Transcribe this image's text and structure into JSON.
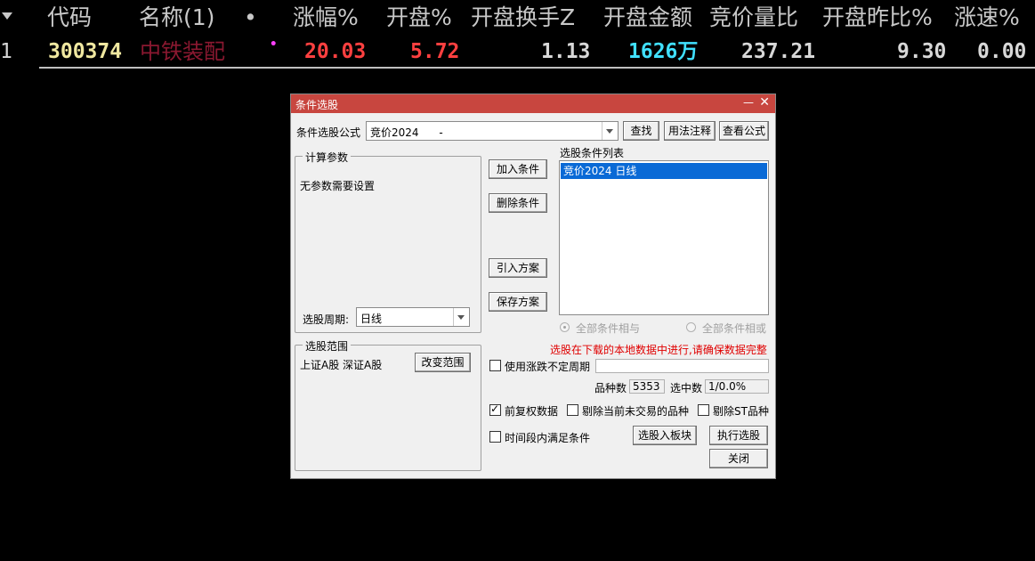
{
  "table": {
    "headers": [
      "代码",
      "名称(1)",
      "•",
      "涨幅%",
      "开盘%",
      "开盘换手Z",
      "开盘金额",
      "竞价量比",
      "开盘昨比%",
      "涨速%"
    ],
    "row": {
      "index": "1",
      "code": "300374",
      "name": "中铁装配",
      "marker": "•",
      "change_pct": "20.03",
      "open_pct": "5.72",
      "open_turnover": "1.13",
      "open_amount": "1626万",
      "auction_ratio": "237.21",
      "open_prev_ratio": "9.30",
      "speed_pct": "0.00"
    },
    "colors": {
      "header": "#c8c8c8",
      "code": "#f0e8a0",
      "name": "#8a1830",
      "red": "#ff4040",
      "white": "#d8d8d8",
      "cyan": "#40e0ff"
    }
  },
  "dialog": {
    "title": "条件选股",
    "min_glyph": "—",
    "close_glyph": "✕",
    "formula_label": "条件选股公式",
    "formula_value": "竞价2024      -",
    "find_button": "查找",
    "usage_button": "用法注释",
    "view_formula_button": "查看公式",
    "params_group": "计算参数",
    "params_text": "无参数需要设置",
    "period_label": "选股周期:",
    "period_value": "日线",
    "add_button": "加入条件",
    "delete_button": "删除条件",
    "import_button": "引入方案",
    "save_button": "保存方案",
    "list_label": "选股条件列表",
    "list_items": [
      "竞价2024  日线"
    ],
    "radio_and": "全部条件相与",
    "radio_or": "全部条件相或",
    "scope_group": "选股范围",
    "scope_text": "上证A股 深证A股",
    "change_scope_button": "改变范围",
    "warning": "选股在下载的本地数据中进行,请确保数据完整",
    "use_variable_period": "使用涨跌不定周期",
    "count_label": "品种数",
    "count_value": "5353",
    "selected_label": "选中数",
    "selected_value": "1/0.0%",
    "fq_label": "前复权数据",
    "fq_checked": true,
    "exclude_no_trade": "剔除当前未交易的品种",
    "exclude_st": "剔除ST品种",
    "time_period": "时间段内满足条件",
    "to_block_button": "选股入板块",
    "execute_button": "执行选股",
    "close_button": "关闭",
    "accent": "#c8463f",
    "select_color": "#0a6ad6",
    "warn_color": "#e00000"
  }
}
